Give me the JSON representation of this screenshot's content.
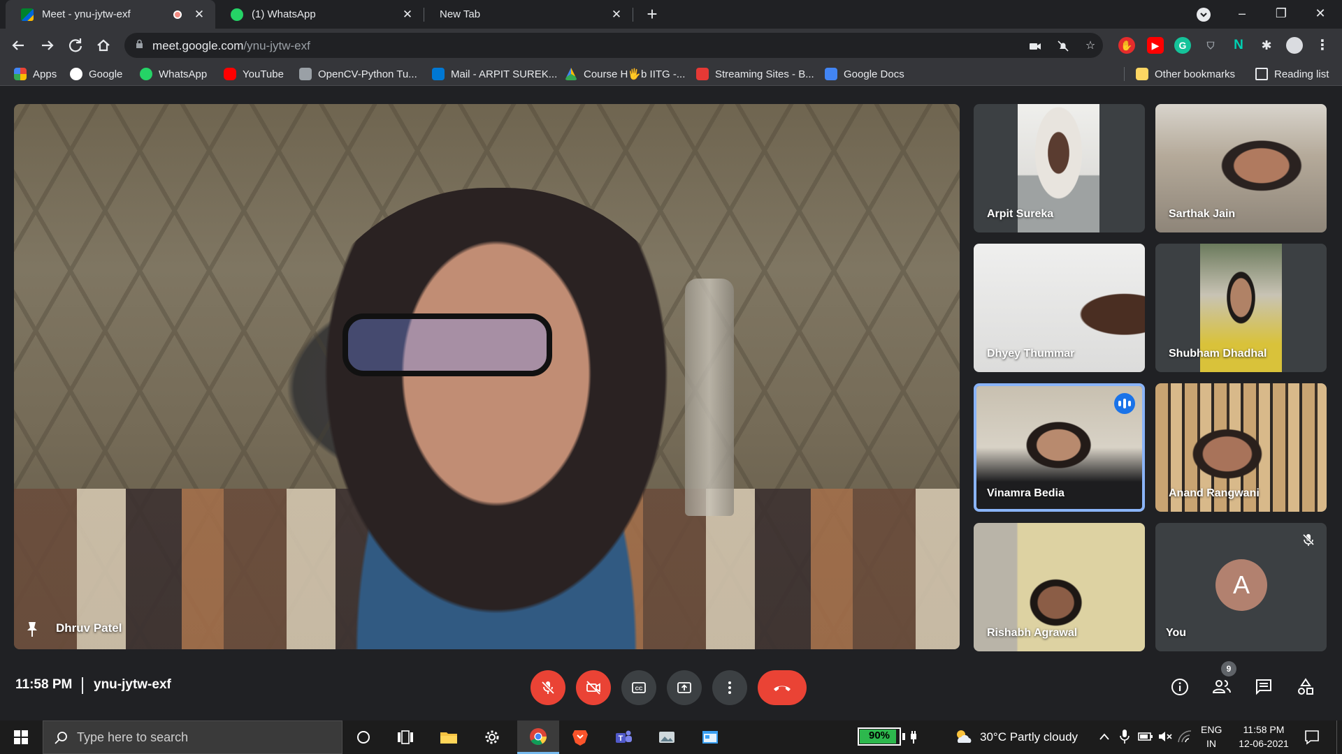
{
  "browser": {
    "tabs": [
      {
        "title": "Meet - ynu-jytw-exf",
        "active": true,
        "recording": true
      },
      {
        "title": "(1) WhatsApp",
        "active": false
      },
      {
        "title": "New Tab",
        "active": false
      }
    ],
    "new_tab_glyph": "+",
    "address": {
      "host": "meet.google.com",
      "path": "/ynu-jytw-exf"
    },
    "bookmarks": [
      {
        "label": "Apps",
        "icon": "apps-grid-icon",
        "color": "#ea4335"
      },
      {
        "label": "Google",
        "icon": "google-icon",
        "color": "#ffffff"
      },
      {
        "label": "WhatsApp",
        "icon": "whatsapp-icon",
        "color": "#25d366"
      },
      {
        "label": "YouTube",
        "icon": "youtube-icon",
        "color": "#ff0000"
      },
      {
        "label": "OpenCV-Python Tu...",
        "icon": "document-icon",
        "color": "#9aa0a6"
      },
      {
        "label": "Mail - ARPIT SUREK...",
        "icon": "outlook-icon",
        "color": "#0078d4"
      },
      {
        "label": "Course H🖐b IITG -...",
        "icon": "drive-icon",
        "color": "#fbbc04"
      },
      {
        "label": "Streaming Sites - B...",
        "icon": "streaming-icon",
        "color": "#e53935"
      },
      {
        "label": "Google Docs",
        "icon": "google-docs-icon",
        "color": "#4285f4"
      }
    ],
    "other_bookmarks": "Other bookmarks",
    "reading_list": "Reading list"
  },
  "meet": {
    "main_speaker": "Dhruv Patel",
    "participants": [
      {
        "name": "Arpit Sureka"
      },
      {
        "name": "Sarthak Jain"
      },
      {
        "name": "Dhyey Thummar"
      },
      {
        "name": "Shubham Dhadhal"
      },
      {
        "name": "Vinamra Bedia",
        "speaking": true
      },
      {
        "name": "Anand Rangwani"
      },
      {
        "name": "Rishabh Agrawal"
      },
      {
        "name": "You",
        "avatar_letter": "A",
        "muted": true
      }
    ],
    "time": "11:58 PM",
    "meeting_code": "ynu-jytw-exf",
    "people_count": "9",
    "accent": "#ea4335",
    "speaking_color": "#8ab4f8"
  },
  "taskbar": {
    "search_placeholder": "Type here to search",
    "battery": "90%",
    "weather": "30°C  Partly cloudy",
    "lang_top": "ENG",
    "lang_bottom": "IN",
    "clock_time": "11:58 PM",
    "clock_date": "12-06-2021"
  }
}
